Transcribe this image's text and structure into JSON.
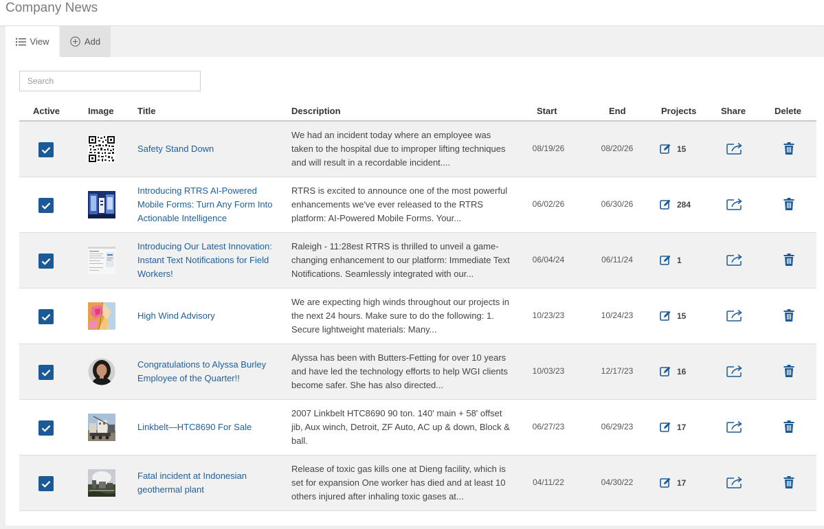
{
  "page": {
    "title": "Company News"
  },
  "tabs": [
    {
      "label": "View",
      "icon": "list-icon",
      "active": true
    },
    {
      "label": "Add",
      "icon": "plus-circle-icon",
      "active": false
    }
  ],
  "search": {
    "placeholder": "Search",
    "value": ""
  },
  "columns": [
    "Active",
    "Image",
    "Title",
    "Description",
    "Start",
    "End",
    "Projects",
    "Share",
    "Delete"
  ],
  "colors": {
    "accent": "#1b5a96",
    "link": "#1e5f9e",
    "row_alt": "#f1f1f1"
  },
  "rows": [
    {
      "active": true,
      "image": "qr-code-image",
      "title": "Safety Stand Down",
      "description": "We had an incident today where an employee was taken to the hospital due to improper lifting techniques and will result in a recordable incident....",
      "start": "08/19/26",
      "end": "08/20/26",
      "projects": "15"
    },
    {
      "active": true,
      "image": "mobile-forms-image",
      "title": "Introducing RTRS AI-Powered Mobile Forms: Turn Any Form Into Actionable Intelligence",
      "description": "RTRS is excited to announce one of the most powerful enhancements we've ever released to the RTRS platform: AI-Powered Mobile Forms. Your...",
      "start": "06/02/26",
      "end": "06/30/26",
      "projects": "284"
    },
    {
      "active": true,
      "image": "notifications-screenshot-image",
      "title": "Introducing Our Latest Innovation: Instant Text Notifications for Field Workers!",
      "description": "Raleigh - 11:28est RTRS is thrilled to unveil a game-changing enhancement to our platform: Immediate Text Notifications. Seamlessly integrated with our...",
      "start": "06/04/24",
      "end": "06/11/24",
      "projects": "1"
    },
    {
      "active": true,
      "image": "weather-map-image",
      "title": "High Wind Advisory",
      "description": "We are expecting high winds throughout our projects in the next 24 hours. Make sure to do the following: 1. Secure lightweight materials: Many...",
      "start": "10/23/23",
      "end": "10/24/23",
      "projects": "15"
    },
    {
      "active": true,
      "image": "employee-portrait-image",
      "title": "Congratulations to Alyssa Burley Employee of the Quarter!!",
      "description": "Alyssa has been with Butters-Fetting for over 10 years and have led the technology efforts to help WGI clients become safer. She has also directed...",
      "start": "10/03/23",
      "end": "12/17/23",
      "projects": "16"
    },
    {
      "active": true,
      "image": "crane-photo-image",
      "title": "Linkbelt—HTC8690 For Sale",
      "description": "2007 Linkbelt HTC8690 90 ton. 140' main + 58' offset jib, Aux winch, Detroit, ZF Auto, AC up & down, Block & ball.",
      "start": "06/27/23",
      "end": "06/29/23",
      "projects": "17"
    },
    {
      "active": true,
      "image": "geothermal-plant-image",
      "title": "Fatal incident at Indonesian geothermal plant",
      "description": "Release of toxic gas kills one at Dieng facility, which is set for expansion One worker has died and at least 10 others injured after inhaling toxic gases at...",
      "start": "04/11/22",
      "end": "04/30/22",
      "projects": "17"
    }
  ]
}
